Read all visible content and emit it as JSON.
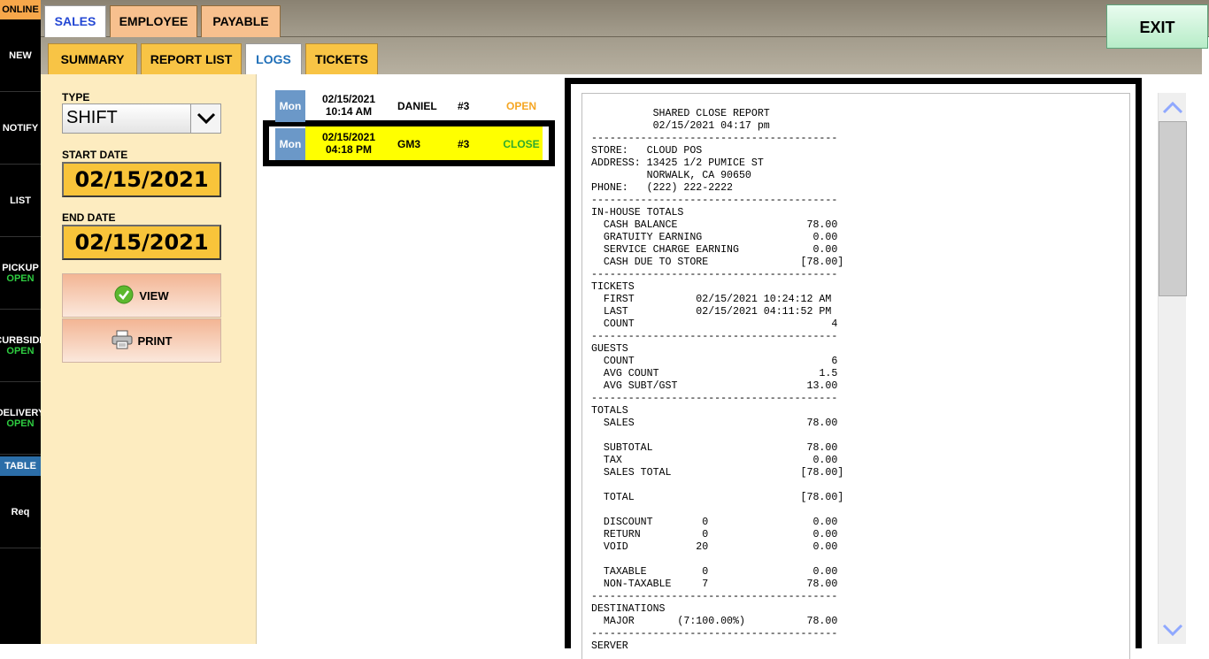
{
  "sidebar": {
    "status": "ONLINE",
    "items": [
      {
        "label": "NEW",
        "sub": ""
      },
      {
        "label": "NOTIFY",
        "sub": ""
      },
      {
        "label": "LIST",
        "sub": ""
      },
      {
        "label": "PICKUP",
        "sub": "OPEN"
      },
      {
        "label": "CURBSIDE",
        "sub": "OPEN"
      },
      {
        "label": "DELIVERY",
        "sub": "OPEN"
      }
    ],
    "section_label": "TABLE",
    "req_label": "Req"
  },
  "top_tabs": {
    "sales": "SALES",
    "employee": "EMPLOYEE",
    "payable": "PAYABLE"
  },
  "exit_label": "EXIT",
  "sub_tabs": {
    "summary": "SUMMARY",
    "report_list": "REPORT LIST",
    "logs": "LOGS",
    "tickets": "TICKETS"
  },
  "filter": {
    "type_label": "TYPE",
    "type_value": "SHIFT",
    "start_label": "START DATE",
    "start_value": "02/15/2021",
    "end_label": "END DATE",
    "end_value": "02/15/2021",
    "view_label": "VIEW",
    "print_label": "PRINT"
  },
  "logs": [
    {
      "day": "Mon",
      "date": "02/15/2021",
      "time": "10:14 AM",
      "employee": "DANIEL",
      "number": "#3",
      "status": "OPEN"
    },
    {
      "day": "Mon",
      "date": "02/15/2021",
      "time": "04:18 PM",
      "employee": "GM3",
      "number": "#3",
      "status": "CLOSE"
    }
  ],
  "colors": {
    "open_status": "#f5a623",
    "close_status": "#2eaa2e",
    "selected_row": "#ffff00",
    "sidebar_open": "#2ecc40"
  },
  "report": {
    "text": "          SHARED CLOSE REPORT\n          02/15/2021 04:17 pm\n----------------------------------------\nSTORE:   CLOUD POS\nADDRESS: 13425 1/2 PUMICE ST\n         NORWALK, CA 90650\nPHONE:   (222) 222-2222\n----------------------------------------\nIN-HOUSE TOTALS\n  CASH BALANCE                     78.00\n  GRATUITY EARNING                  0.00\n  SERVICE CHARGE EARNING            0.00\n  CASH DUE TO STORE               [78.00]\n----------------------------------------\nTICKETS\n  FIRST          02/15/2021 10:24:12 AM\n  LAST           02/15/2021 04:11:52 PM\n  COUNT                                4\n----------------------------------------\nGUESTS\n  COUNT                                6\n  AVG COUNT                          1.5\n  AVG SUBT/GST                     13.00\n----------------------------------------\nTOTALS\n  SALES                            78.00\n\n  SUBTOTAL                         78.00\n  TAX                               0.00\n  SALES TOTAL                     [78.00]\n\n  TOTAL                           [78.00]\n\n  DISCOUNT        0                 0.00\n  RETURN          0                 0.00\n  VOID           20                 0.00\n\n  TAXABLE         0                 0.00\n  NON-TAXABLE     7                78.00\n----------------------------------------\nDESTINATIONS\n  MAJOR       (7:100.00%)          78.00\n----------------------------------------\nSERVER"
  }
}
